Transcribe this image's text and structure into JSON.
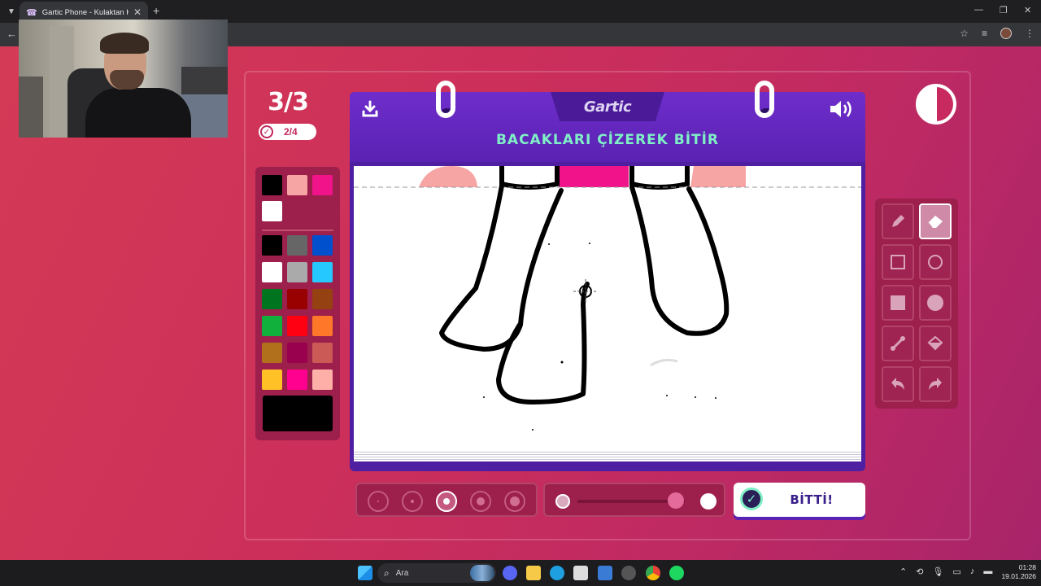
{
  "browser": {
    "tab_title": "Gartic Phone - Kulaktan Kulağa",
    "tab_close": "✕",
    "new_tab": "+",
    "win_min": "—",
    "win_restore": "❐",
    "win_close": "✕",
    "back": "←"
  },
  "game": {
    "round": "3/3",
    "progress": "2/4",
    "logo": "Gartic",
    "prompt": "BACAKLARI ÇİZEREK BİTİR",
    "done_label": "BİTTİ!",
    "timer_remaining_fraction": 0.55,
    "opacity_level": 0.92,
    "selected_brush_size_index": 2,
    "current_color": "#000000",
    "selected_tool": "eraser"
  },
  "palette": {
    "top_colors": [
      "#000000",
      "#f7a4a4",
      "#f0138a",
      "#ffffff"
    ],
    "grid_colors": [
      "#000000",
      "#666666",
      "#0050cd",
      "#ffffff",
      "#aaaaaa",
      "#26c9ff",
      "#017420",
      "#990000",
      "#964112",
      "#11b03c",
      "#ff0013",
      "#ff7829",
      "#b0701c",
      "#99004e",
      "#cb5a57",
      "#ffc126",
      "#ff008f",
      "#feafa8"
    ]
  },
  "tools": [
    "pencil",
    "eraser",
    "rectangle-outline",
    "circle-outline",
    "rectangle-filled",
    "circle-filled",
    "line",
    "bucket",
    "undo",
    "redo"
  ],
  "taskbar": {
    "search_label": "Ara",
    "time": "01:28",
    "date": "19.01.2026"
  }
}
